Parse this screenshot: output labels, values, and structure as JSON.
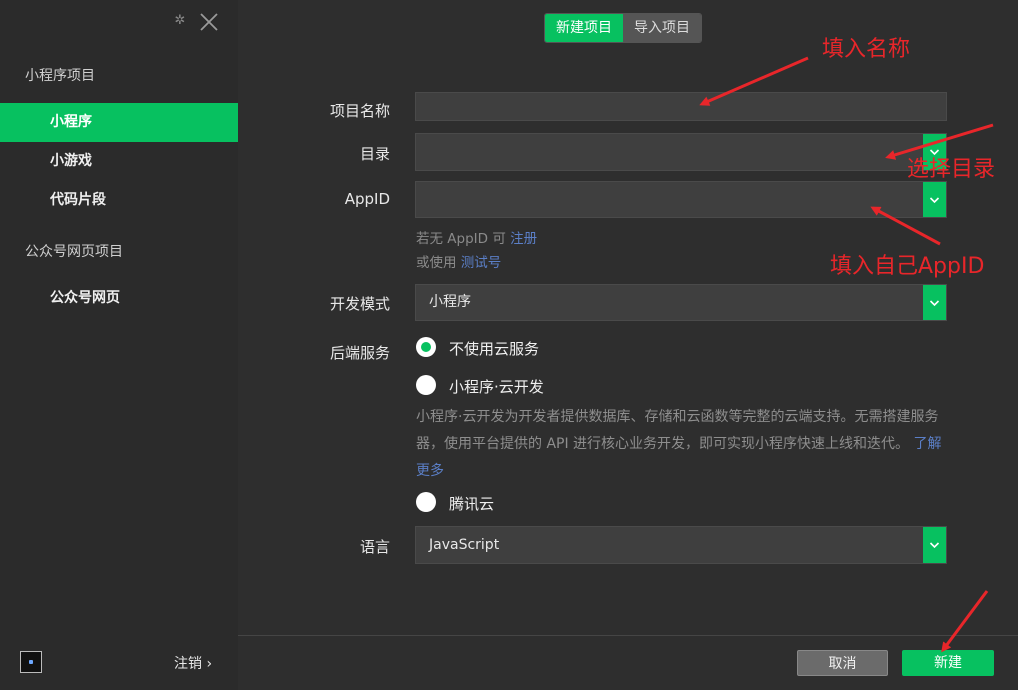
{
  "sidebar": {
    "section_miniprogram": "小程序项目",
    "items": [
      {
        "label": "小程序"
      },
      {
        "label": "小游戏"
      },
      {
        "label": "代码片段"
      }
    ],
    "section_official": "公众号网页项目",
    "official_items": [
      {
        "label": "公众号网页"
      }
    ],
    "logout_label": "注销 ›"
  },
  "tabs": [
    {
      "label": "新建项目"
    },
    {
      "label": "导入项目"
    }
  ],
  "form": {
    "name_label": "项目名称",
    "name_value": "",
    "dir_label": "目录",
    "dir_value": "",
    "appid_label": "AppID",
    "appid_value": "",
    "appid_hint_prefix": "若无 AppID 可",
    "appid_hint_link": "注册",
    "appid_hint2_prefix": "或使用",
    "appid_hint2_link": "测试号",
    "mode_label": "开发模式",
    "mode_value": "小程序",
    "backend_label": "后端服务",
    "backend_options": [
      {
        "label": "不使用云服务",
        "selected": true
      },
      {
        "label": "小程序·云开发",
        "selected": false
      },
      {
        "label": "腾讯云",
        "selected": false
      }
    ],
    "cloud_desc": "小程序·云开发为开发者提供数据库、存储和云函数等完整的云端支持。无需搭建服务器，使用平台提供的 API 进行核心业务开发，即可实现小程序快速上线和迭代。",
    "cloud_desc_link": "了解更多",
    "lang_label": "语言",
    "lang_value": "JavaScript"
  },
  "footer": {
    "cancel_label": "取消",
    "create_label": "新建"
  },
  "annotations": {
    "fill_name": "填入名称",
    "select_dir": "选择目录",
    "fill_appid": "填入自己AppID"
  },
  "colors": {
    "accent": "#07c160",
    "annotation": "#e8262a",
    "link": "#5b7fc7"
  }
}
